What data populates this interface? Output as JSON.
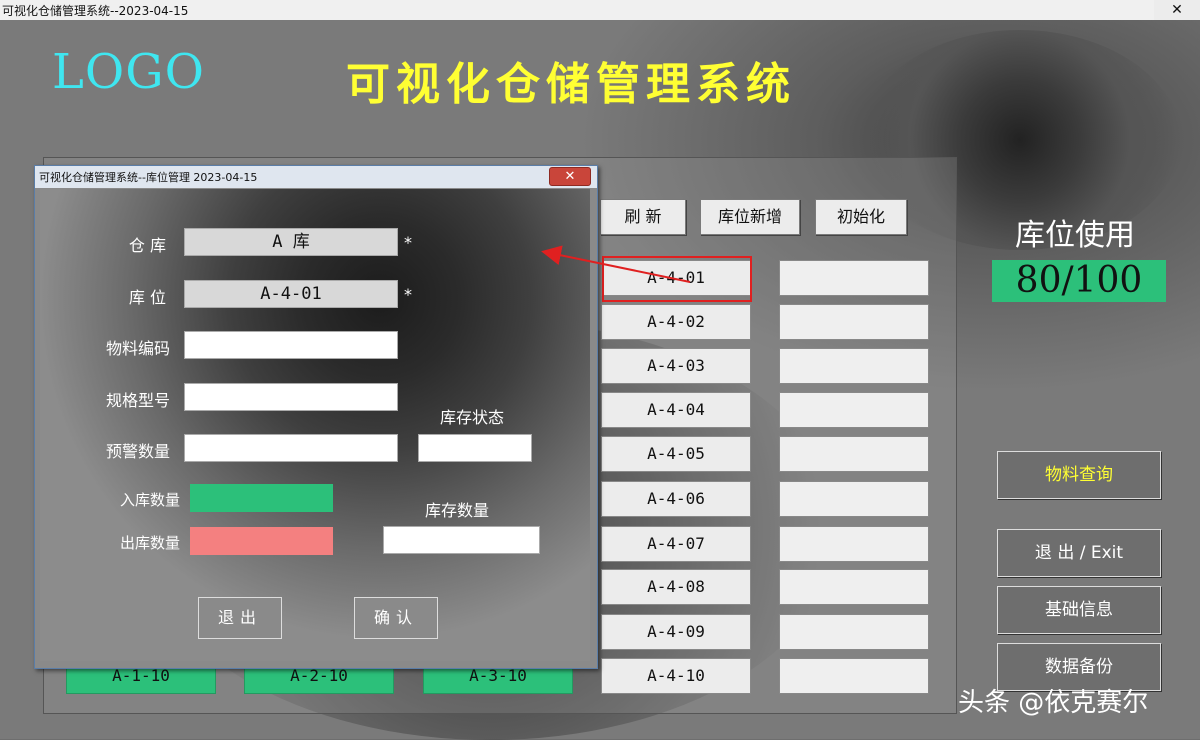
{
  "window": {
    "title": "可视化仓储管理系统--2023-04-15",
    "close_glyph": "✕"
  },
  "header": {
    "logo": "LOGO",
    "app_title": "可视化仓储管理系统"
  },
  "toolbar": {
    "refresh": "刷 新",
    "add_slot": "库位新增",
    "init": "初始化"
  },
  "slots_col4": [
    "A-4-01",
    "A-4-02",
    "A-4-03",
    "A-4-04",
    "A-4-05",
    "A-4-06",
    "A-4-07",
    "A-4-08",
    "A-4-09",
    "A-4-10"
  ],
  "bottom_slots": [
    "A-1-10",
    "A-2-10",
    "A-3-10"
  ],
  "usage": {
    "label": "库位使用",
    "value": "80/100",
    "color": "#2cc07a"
  },
  "side_buttons": {
    "material_query": "物料查询",
    "exit": "退 出 / Exit",
    "basic_info": "基础信息",
    "backup": "数据备份"
  },
  "watermark": "头条 @依克赛尔",
  "dialog": {
    "title": "可视化仓储管理系统--库位管理 2023-04-15",
    "close_glyph": "✕",
    "warehouse_label": "仓 库",
    "warehouse_value": "A 库",
    "location_label": "库 位",
    "location_value": "A-4-01",
    "required_mark": "*",
    "material_code_label": "物料编码",
    "material_code_value": "",
    "spec_label": "规格型号",
    "spec_value": "",
    "warning_qty_label": "预警数量",
    "warning_qty_value": "",
    "stock_status_label": "库存状态",
    "stock_status_value": "",
    "in_qty_label": "入库数量",
    "in_qty_value": "",
    "out_qty_label": "出库数量",
    "out_qty_value": "",
    "stock_qty_label": "库存数量",
    "stock_qty_value": "",
    "exit_button": "退出",
    "confirm_button": "确认",
    "colors": {
      "in": "#2cc07a",
      "out": "#f48080"
    }
  },
  "colors": {
    "accent_yellow": "#ffff33",
    "logo_cyan": "#3fe6f0",
    "highlight_red": "#e02020"
  }
}
